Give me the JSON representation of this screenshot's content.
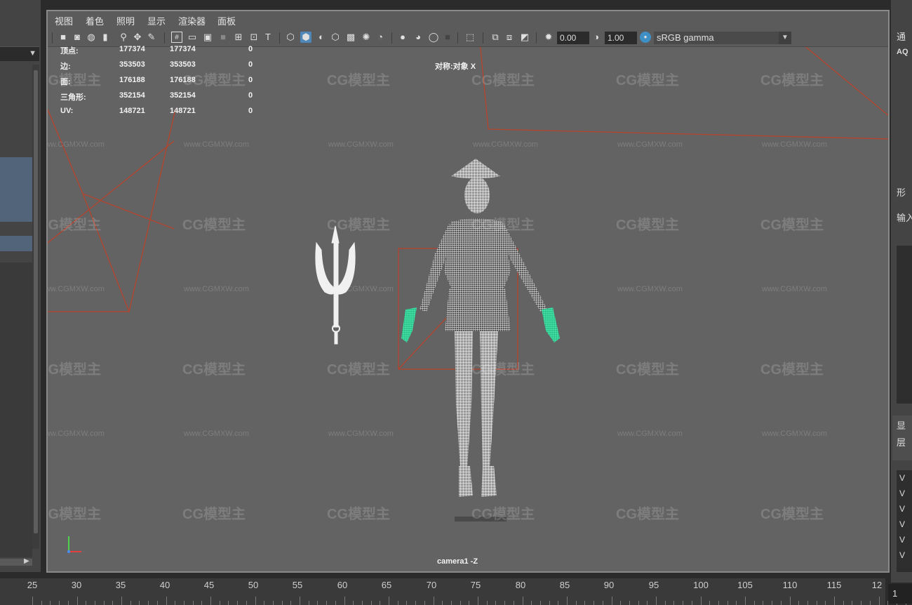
{
  "menu": [
    "视图",
    "着色",
    "照明",
    "显示",
    "渲染器",
    "面板"
  ],
  "toolbar": {
    "exposure_value": "0.00",
    "gamma_value": "1.00",
    "color_space": "sRGB gamma"
  },
  "hud": {
    "rows": [
      {
        "label": "顶点:",
        "a": "177374",
        "b": "177374",
        "c": "0"
      },
      {
        "label": "边:",
        "a": "353503",
        "b": "353503",
        "c": "0"
      },
      {
        "label": "面:",
        "a": "176188",
        "b": "176188",
        "c": "0"
      },
      {
        "label": "三角形:",
        "a": "352154",
        "b": "352154",
        "c": "0"
      },
      {
        "label": "UV:",
        "a": "148721",
        "b": "148721",
        "c": "0"
      }
    ],
    "symmetry": "对称:对象 X",
    "camera": "camera1 -Z"
  },
  "right_panel": {
    "tab_top": "通",
    "label_aq": "AQ",
    "label_shape": "形",
    "label_input": "输入",
    "label_display": "显",
    "label_layer": "层",
    "list_items": [
      "V",
      "V",
      "V",
      "V",
      "V",
      "V"
    ]
  },
  "timeline": {
    "ticks": [
      "25",
      "30",
      "35",
      "40",
      "45",
      "50",
      "55",
      "60",
      "65",
      "70",
      "75",
      "80",
      "85",
      "90",
      "95",
      "100",
      "105",
      "110",
      "115",
      "12"
    ],
    "current_frame": "1"
  },
  "watermark": {
    "logo": "CG模型主",
    "url": "www.CGMXW.com"
  },
  "colors": {
    "viewport_bg": "#636363",
    "wire_selected": "#3ee8a6",
    "curve": "#b5432c",
    "active_icon": "#4f88b8"
  }
}
